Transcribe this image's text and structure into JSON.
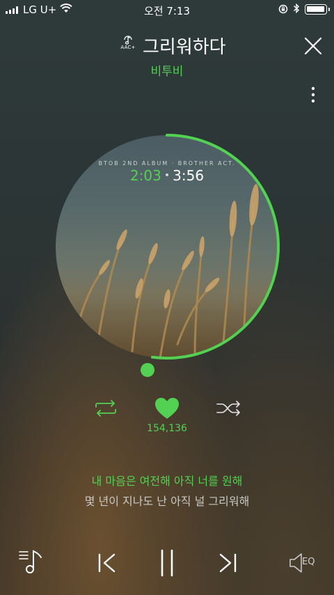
{
  "status_bar": {
    "carrier": "LG U+",
    "time": "오전 7:13"
  },
  "header": {
    "quality_badge": "AAC+",
    "song_title": "그리워하다",
    "artist": "비투비"
  },
  "album": {
    "caption": "BTOB 2ND ALBUM · BROTHER ACT.",
    "current_time": "2:03",
    "separator": "•",
    "total_time": "3:56",
    "progress": 0.521
  },
  "controls": {
    "like_count": "154,136"
  },
  "lyrics": {
    "current_line": "내 마음은 여전해 아직 너를 원해",
    "next_line": "몇 년이 지나도 난 아직 널 그리워해"
  },
  "bottom_bar": {
    "eq_label": "EQ"
  },
  "colors": {
    "accent": "#52d152",
    "text": "#ffffff",
    "muted_text": "#c9c9c4"
  },
  "icons": [
    "signal-icon",
    "wifi-icon",
    "rotation-lock-icon",
    "bluetooth-icon",
    "battery-icon",
    "music-note-icon",
    "close-icon",
    "more-vertical-icon",
    "repeat-icon",
    "heart-icon",
    "shuffle-icon",
    "playlist-icon",
    "previous-icon",
    "pause-icon",
    "next-icon",
    "speaker-icon"
  ]
}
